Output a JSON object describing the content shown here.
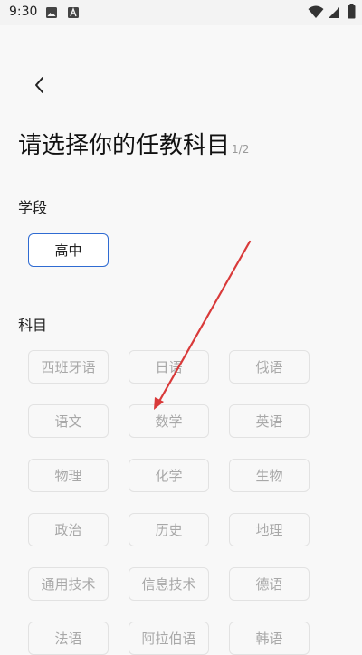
{
  "status_bar": {
    "time": "9:30",
    "icons": [
      "gallery-icon",
      "font-icon",
      "wifi-icon",
      "signal-icon",
      "battery-icon"
    ]
  },
  "header": {
    "back_icon": "chevron-left-icon",
    "title": "请选择你的任教科目",
    "step": "1/2"
  },
  "stage_section": {
    "label": "学段",
    "selected": "高中"
  },
  "subject_section": {
    "label": "科目",
    "subjects": [
      "西班牙语",
      "日语",
      "俄语",
      "语文",
      "数学",
      "英语",
      "物理",
      "化学",
      "生物",
      "政治",
      "历史",
      "地理",
      "通用技术",
      "信息技术",
      "德语",
      "法语",
      "阿拉伯语",
      "韩语"
    ]
  },
  "colors": {
    "accent": "#2f6bd2",
    "annotation": "#d93a3a",
    "chip_text": "#a8a8a8"
  }
}
